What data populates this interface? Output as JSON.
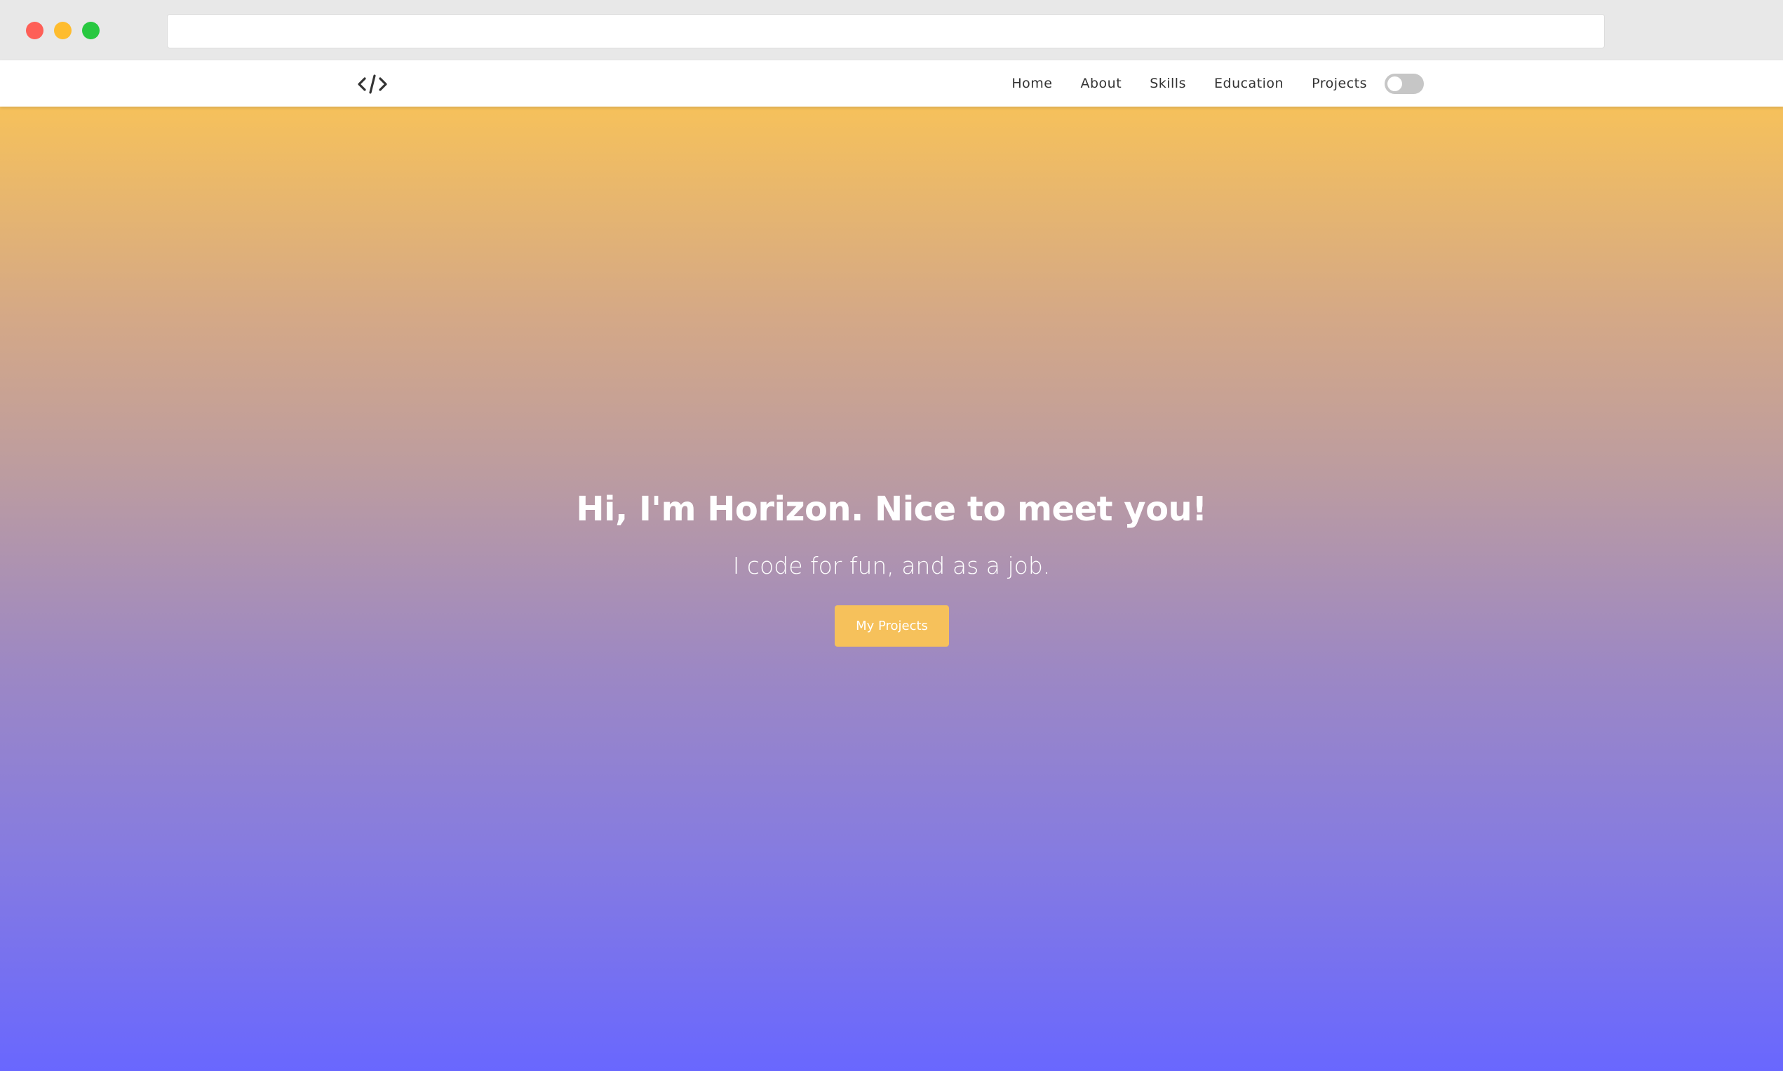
{
  "browser": {
    "address_value": "",
    "window_buttons": [
      "close",
      "minimize",
      "maximize"
    ]
  },
  "navbar": {
    "logo_icon": "code-brackets-icon",
    "links": [
      "Home",
      "About",
      "Skills",
      "Education",
      "Projects"
    ],
    "theme_toggle_on": false
  },
  "hero": {
    "title": "Hi, I'm Horizon. Nice to meet you!",
    "subtitle": "I code for fun, and as a job.",
    "button_label": "My Projects"
  },
  "colors": {
    "gradient_top": "#f6c15b",
    "gradient_bottom": "#6967fe",
    "button_bg": "#f6c15b",
    "nav_text": "#333333"
  }
}
